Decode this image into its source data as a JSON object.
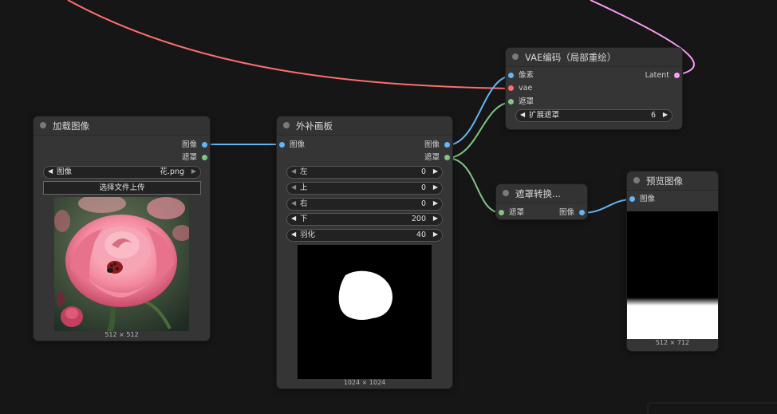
{
  "colors": {
    "background": "#161616",
    "node_bg": "#353535",
    "wire_image": "#64b5f6",
    "wire_mask": "#81c784",
    "wire_vae": "#ff6e6e",
    "wire_latent": "#ff9cf9"
  },
  "nodes": {
    "load_image": {
      "title": "加载图像",
      "outputs": [
        "图像",
        "遮罩"
      ],
      "image_widget": {
        "label": "图像",
        "value": "花.png"
      },
      "upload_button": "选择文件上传",
      "dimensions": "512 × 512"
    },
    "outpaint": {
      "title": "外补画板",
      "input": "图像",
      "outputs": [
        "图像",
        "遮罩"
      ],
      "widgets": [
        {
          "label": "左",
          "value": "0"
        },
        {
          "label": "上",
          "value": "0"
        },
        {
          "label": "右",
          "value": "0"
        },
        {
          "label": "下",
          "value": "200"
        },
        {
          "label": "羽化",
          "value": "40"
        }
      ],
      "dimensions": "1024 × 1024"
    },
    "vae_encode": {
      "title": "VAE编码（局部重绘）",
      "inputs": [
        "像素",
        "vae",
        "遮罩"
      ],
      "output": "Latent",
      "widget": {
        "label": "扩展遮罩",
        "value": "6"
      }
    },
    "mask_convert": {
      "title": "遮罩转换...",
      "input": "遮罩",
      "output": "图像"
    },
    "preview": {
      "title": "预览图像",
      "input": "图像",
      "dimensions": "512 × 712"
    }
  }
}
